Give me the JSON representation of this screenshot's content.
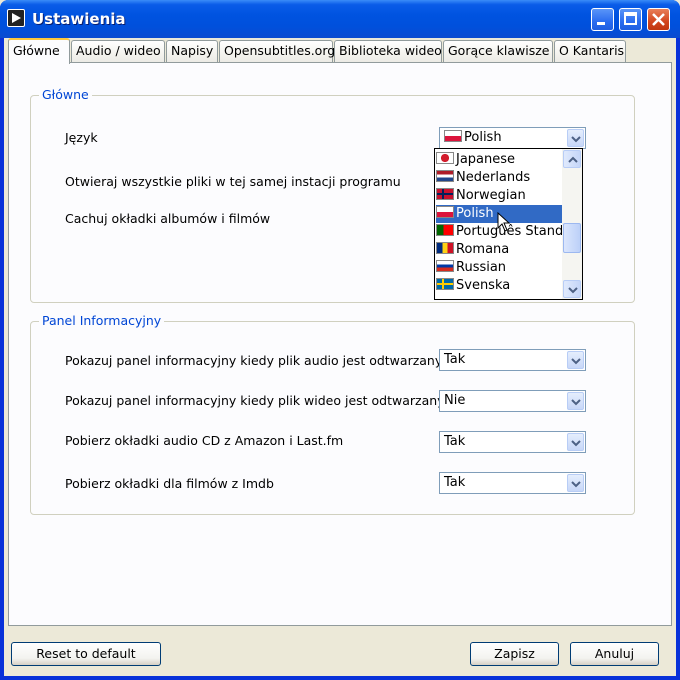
{
  "window": {
    "title": "Ustawienia"
  },
  "tabs": [
    {
      "label": "Główne"
    },
    {
      "label": "Audio / wideo"
    },
    {
      "label": "Napisy"
    },
    {
      "label": "Opensubtitles.org"
    },
    {
      "label": "Biblioteka wideo"
    },
    {
      "label": "Gorące klawisze"
    },
    {
      "label": "O Kantaris"
    }
  ],
  "general": {
    "legend": "Główne",
    "language_label": "Język",
    "language_value": "Polish",
    "single_instance_label": "Otwieraj wszystkie pliki w tej samej instacji programu",
    "cache_covers_label": "Cachuj okładki albumów i filmów"
  },
  "language_dropdown": {
    "options": [
      {
        "label": "Japanese",
        "flag": [
          "#ffffff",
          "#d21c2c"
        ]
      },
      {
        "label": "Nederlands",
        "flag": [
          "#ae1c28",
          "#ffffff",
          "#21468b"
        ]
      },
      {
        "label": "Norwegian",
        "flag": [
          "#c8102e",
          "#ffffff",
          "#00205b"
        ]
      },
      {
        "label": "Polish",
        "flag": [
          "#ffffff",
          "#dc143c"
        ]
      },
      {
        "label": "Português Standard",
        "flag": [
          "#006600",
          "#ff0000"
        ]
      },
      {
        "label": "Romana",
        "flag": [
          "#002b7f",
          "#fcd116",
          "#ce1126"
        ]
      },
      {
        "label": "Russian",
        "flag": [
          "#ffffff",
          "#0039a6",
          "#d52b1e"
        ]
      },
      {
        "label": "Svenska",
        "flag": [
          "#006aa7",
          "#fecc00"
        ]
      }
    ],
    "selected_index": 3
  },
  "info_panel": {
    "legend": "Panel Informacyjny",
    "rows": [
      {
        "label": "Pokazuj panel informacyjny kiedy plik audio jest odtwarzany",
        "value": "Tak"
      },
      {
        "label": "Pokazuj panel informacyjny kiedy plik wideo jest odtwarzany",
        "value": "Nie"
      },
      {
        "label": "Pobierz okładki audio CD z Amazon i Last.fm",
        "value": "Tak"
      },
      {
        "label": "Pobierz okładki dla filmów z Imdb",
        "value": "Tak"
      }
    ]
  },
  "footer": {
    "reset_label": "Reset to default",
    "save_label": "Zapisz",
    "cancel_label": "Anuluj"
  },
  "colors": {
    "titlebar": "#0053e0",
    "selection": "#316ac5",
    "group_legend": "#0046d5"
  }
}
